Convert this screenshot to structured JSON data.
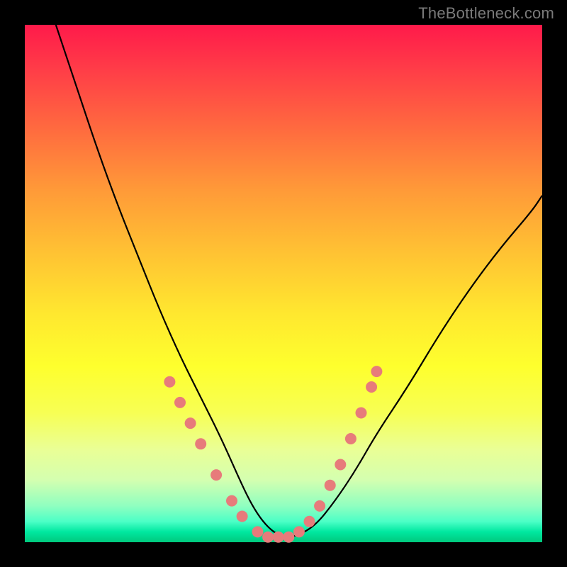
{
  "watermark": "TheBottleneck.com",
  "chart_data": {
    "type": "line",
    "title": "",
    "xlabel": "",
    "ylabel": "",
    "xlim": [
      0,
      100
    ],
    "ylim": [
      0,
      100
    ],
    "background": "rainbow-gradient-red-to-green-vertical",
    "series": [
      {
        "name": "bottleneck-curve",
        "x": [
          6,
          10,
          14,
          18,
          22,
          26,
          30,
          34,
          38,
          42,
          44,
          46,
          48,
          50,
          52,
          56,
          60,
          64,
          68,
          74,
          80,
          86,
          92,
          98,
          100
        ],
        "values": [
          100,
          88,
          76,
          65,
          55,
          45,
          36,
          28,
          20,
          11,
          7,
          4,
          2,
          1,
          1,
          3,
          8,
          14,
          21,
          30,
          40,
          49,
          57,
          64,
          67
        ]
      }
    ],
    "markers": [
      {
        "x": 28,
        "y": 31
      },
      {
        "x": 30,
        "y": 27
      },
      {
        "x": 32,
        "y": 23
      },
      {
        "x": 34,
        "y": 19
      },
      {
        "x": 37,
        "y": 13
      },
      {
        "x": 40,
        "y": 8
      },
      {
        "x": 42,
        "y": 5
      },
      {
        "x": 45,
        "y": 2
      },
      {
        "x": 47,
        "y": 1
      },
      {
        "x": 49,
        "y": 1
      },
      {
        "x": 51,
        "y": 1
      },
      {
        "x": 53,
        "y": 2
      },
      {
        "x": 55,
        "y": 4
      },
      {
        "x": 57,
        "y": 7
      },
      {
        "x": 59,
        "y": 11
      },
      {
        "x": 61,
        "y": 15
      },
      {
        "x": 63,
        "y": 20
      },
      {
        "x": 65,
        "y": 25
      },
      {
        "x": 67,
        "y": 30
      },
      {
        "x": 68,
        "y": 33
      }
    ],
    "marker_color": "#e77b7b",
    "curve_color": "#000000"
  }
}
